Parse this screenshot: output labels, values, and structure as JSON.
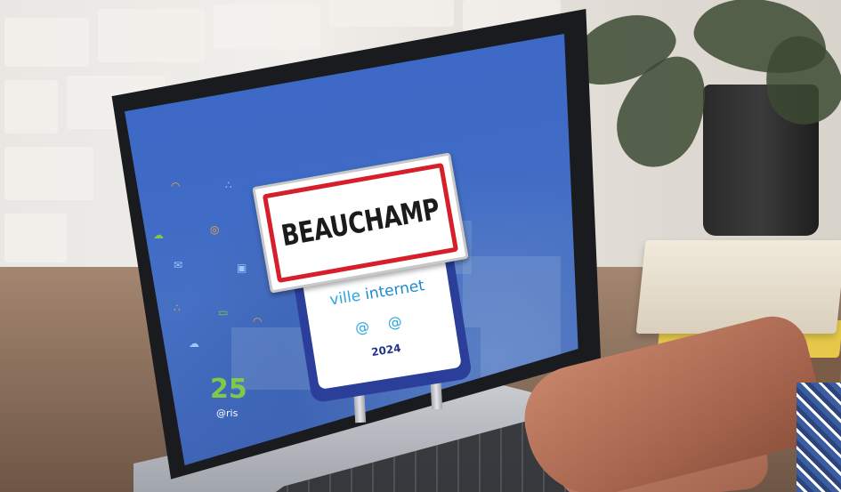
{
  "scene": {
    "sign_text": "BEAUCHAMP",
    "panel": {
      "label_part1": "ville ",
      "label_part2": "internet",
      "at_symbols": "@ @",
      "year": "2024"
    },
    "logo_bottom": {
      "numeral": "25",
      "text": "@ris"
    }
  },
  "colors": {
    "screen_blue": "#3f6bc6",
    "sign_red": "#d61f2a",
    "panel_navy": "#2b3f9a",
    "label_cyan": "#2ba6e0",
    "icon_orange": "#f1a33a",
    "icon_green": "#7ec94a"
  },
  "icons": [
    "wifi-icon",
    "share-icon",
    "cloud-icon",
    "location-pin-icon",
    "mail-icon",
    "lock-icon",
    "chat-icon",
    "cloud-icon"
  ]
}
